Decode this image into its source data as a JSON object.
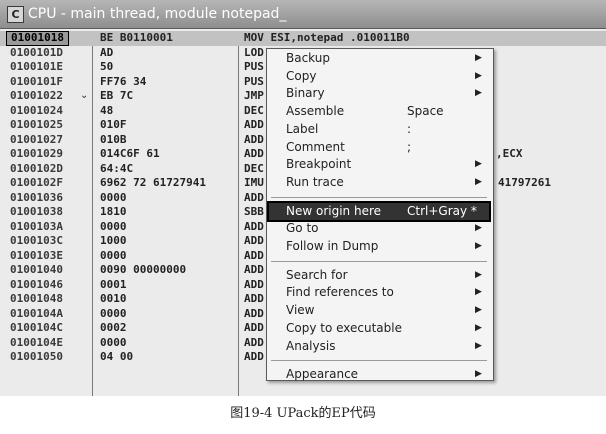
{
  "window": {
    "title": "CPU - main thread, module notepad_",
    "icon_letter": "C",
    "icon": "cpu-window-icon"
  },
  "disassembly": [
    {
      "addr": "01001018",
      "hex": "BE B0110001",
      "asm": "MOV ESI,notepad .010011B0",
      "selected": true
    },
    {
      "addr": "0100101D",
      "hex": "AD",
      "asm": "LOD"
    },
    {
      "addr": "0100101E",
      "hex": "50",
      "asm": "PUS"
    },
    {
      "addr": "0100101F",
      "hex": "FF76 34",
      "asm": "PUS"
    },
    {
      "addr": "01001022",
      "hex": "EB 7C",
      "asm": "JMP",
      "jump": "⌄"
    },
    {
      "addr": "01001024",
      "hex": "48",
      "asm": "DEC"
    },
    {
      "addr": "01001025",
      "hex": "010F",
      "asm": "ADD"
    },
    {
      "addr": "01001027",
      "hex": "010B",
      "asm": "ADD"
    },
    {
      "addr": "01001029",
      "hex": "014C6F 61",
      "asm": "ADD",
      "tail": ",ECX"
    },
    {
      "addr": "0100102D",
      "hex": "64:4C",
      "asm": "DEC"
    },
    {
      "addr": "0100102F",
      "hex": "6962 72 61727941",
      "asm": "IMU",
      "tail": "41797261"
    },
    {
      "addr": "01001036",
      "hex": "0000",
      "asm": "ADD"
    },
    {
      "addr": "01001038",
      "hex": "1810",
      "asm": "SBB"
    },
    {
      "addr": "0100103A",
      "hex": "0000",
      "asm": "ADD"
    },
    {
      "addr": "0100103C",
      "hex": "1000",
      "asm": "ADD"
    },
    {
      "addr": "0100103E",
      "hex": "0000",
      "asm": "ADD"
    },
    {
      "addr": "01001040",
      "hex": "0090 00000000",
      "asm": "ADD"
    },
    {
      "addr": "01001046",
      "hex": "0001",
      "asm": "ADD"
    },
    {
      "addr": "01001048",
      "hex": "0010",
      "asm": "ADD"
    },
    {
      "addr": "0100104A",
      "hex": "0000",
      "asm": "ADD"
    },
    {
      "addr": "0100104C",
      "hex": "0002",
      "asm": "ADD"
    },
    {
      "addr": "0100104E",
      "hex": "0000",
      "asm": "ADD"
    },
    {
      "addr": "01001050",
      "hex": "04 00",
      "asm": "ADD AL,0"
    }
  ],
  "context_menu": {
    "items": [
      {
        "label": "Backup",
        "submenu": true
      },
      {
        "label": "Copy",
        "submenu": true
      },
      {
        "label": "Binary",
        "submenu": true
      },
      {
        "label": "Assemble",
        "shortcut": "Space"
      },
      {
        "label": "Label",
        "shortcut": ":"
      },
      {
        "label": "Comment",
        "shortcut": ";"
      },
      {
        "label": "Breakpoint",
        "submenu": true
      },
      {
        "label": "Run trace",
        "submenu": true
      },
      {
        "separator": true
      },
      {
        "label": "New origin here",
        "shortcut": "Ctrl+Gray *",
        "highlighted": true
      },
      {
        "label": "Go to",
        "submenu": true
      },
      {
        "label": "Follow in Dump",
        "submenu": true
      },
      {
        "separator": true
      },
      {
        "label": "Search for",
        "submenu": true
      },
      {
        "label": "Find references to",
        "submenu": true
      },
      {
        "label": "View",
        "submenu": true
      },
      {
        "label": "Copy to executable",
        "submenu": true
      },
      {
        "label": "Analysis",
        "submenu": true
      },
      {
        "separator": true
      },
      {
        "label": "Appearance",
        "submenu": true
      }
    ],
    "submenu_arrow": "▶"
  },
  "caption": "图19-4    UPack的EP代码"
}
